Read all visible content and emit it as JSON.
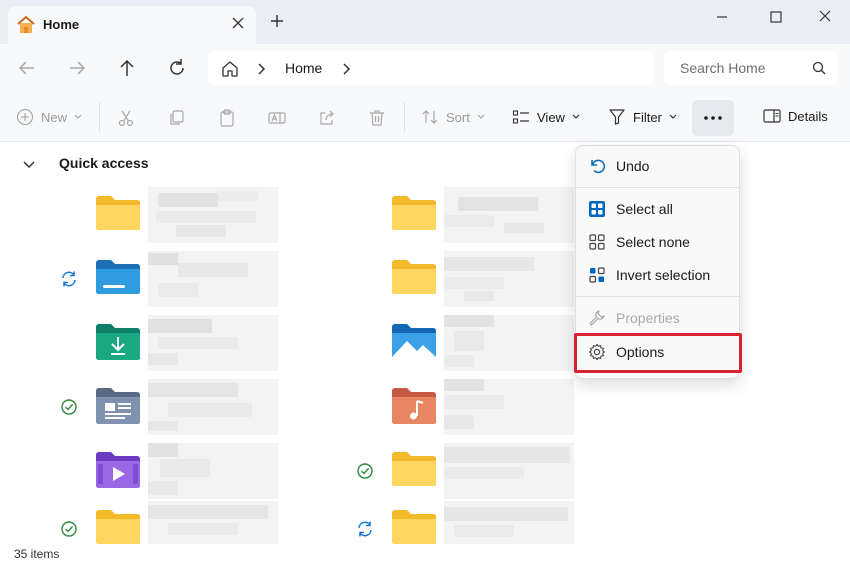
{
  "tab": {
    "title": "Home"
  },
  "address": {
    "segment": "Home"
  },
  "search": {
    "placeholder": "Search Home"
  },
  "toolbar": {
    "new_label": "New",
    "sort_label": "Sort",
    "view_label": "View",
    "filter_label": "Filter",
    "details_label": "Details"
  },
  "quick_access": {
    "title": "Quick access"
  },
  "menu": {
    "undo": "Undo",
    "select_all": "Select all",
    "select_none": "Select none",
    "invert_selection": "Invert selection",
    "properties": "Properties",
    "options": "Options"
  },
  "status": {
    "items_count": "35 items"
  },
  "colors": {
    "accent": "#0067c0",
    "highlight_border": "#d9222f",
    "folder_yellow": "#f8cd4b",
    "sync_blue": "#1976d2",
    "ok_green": "#2e8b3e"
  },
  "items": [
    {
      "icon": "folder-icon",
      "status": ""
    },
    {
      "icon": "folder-icon",
      "status": ""
    },
    {
      "icon": "desktop-folder-icon",
      "status": "sync-icon"
    },
    {
      "icon": "folder-icon",
      "status": ""
    },
    {
      "icon": "downloads-folder-icon",
      "status": ""
    },
    {
      "icon": "pictures-folder-icon",
      "status": ""
    },
    {
      "icon": "documents-folder-icon",
      "status": "available-check-icon"
    },
    {
      "icon": "music-folder-icon",
      "status": ""
    },
    {
      "icon": "videos-folder-icon",
      "status": ""
    },
    {
      "icon": "folder-icon",
      "status": "available-check-icon"
    },
    {
      "icon": "folder-icon",
      "status": "available-check-icon"
    },
    {
      "icon": "folder-icon",
      "status": "sync-icon"
    }
  ]
}
